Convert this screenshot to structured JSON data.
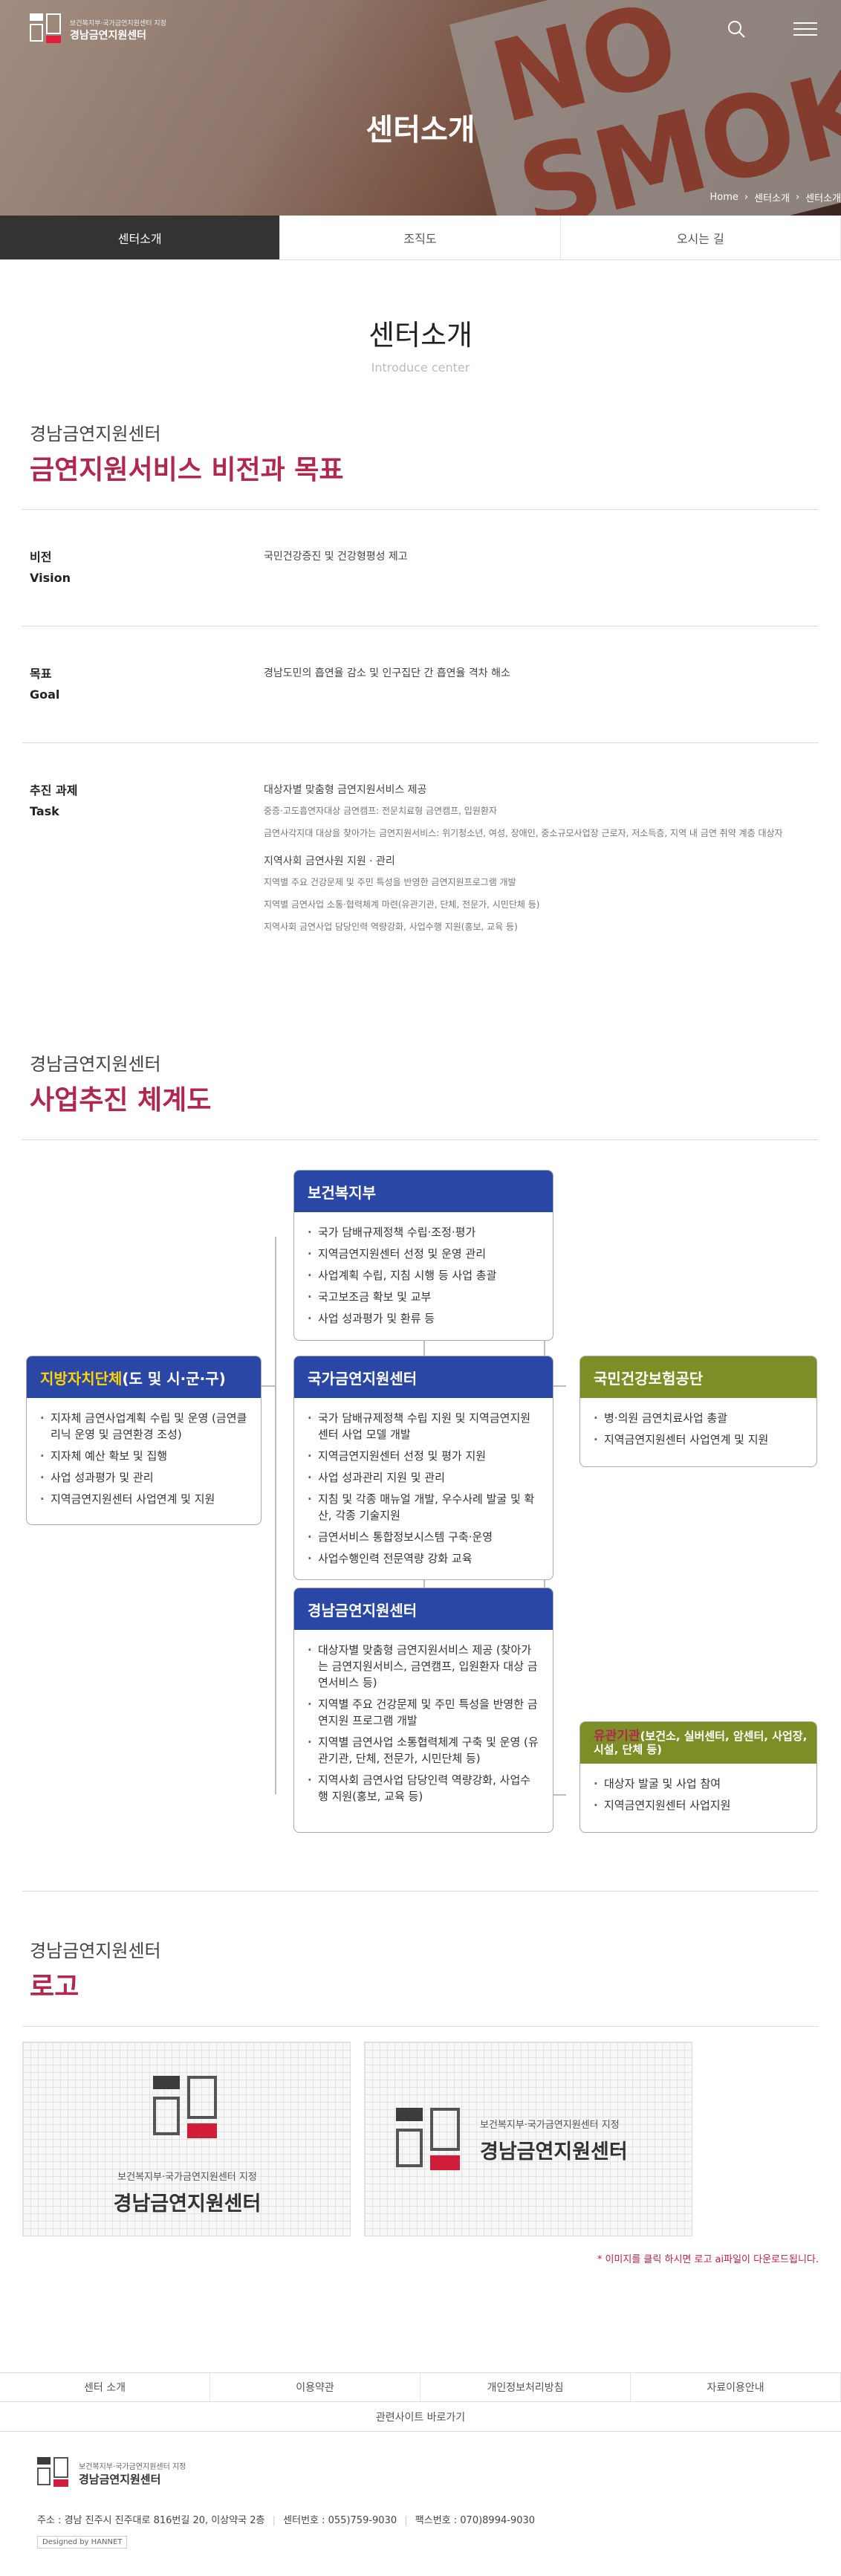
{
  "hero": {
    "logo_small": "보건복지부·국가금연지원센터 지정",
    "logo_name": "경남금연지원센터",
    "title": "센터소개",
    "sign_text": "NO SMOKING",
    "breadcrumb": [
      "Home",
      "센터소개",
      "센터소개"
    ]
  },
  "tabs": [
    "센터소개",
    "조직도",
    "오시는 길"
  ],
  "section": {
    "title": "센터소개",
    "subtitle": "Introduce center"
  },
  "vision": {
    "small": "경남금연지원센터",
    "heading": "금연지원서비스 비전과 목표",
    "rows": [
      {
        "label_ko": "비전",
        "label_en": "Vision",
        "text": "국민건강증진 및 건강형평성 제고"
      },
      {
        "label_ko": "목표",
        "label_en": "Goal",
        "text": "경남도민의 흡연율 감소 및 인구집단 간 흡연율 격차 해소"
      }
    ],
    "task": {
      "label_ko": "추진 과제",
      "label_en": "Task",
      "groups": [
        {
          "title": "대상자별 맞춤형 금연지원서비스 제공",
          "items": [
            "중증·고도흡연자대상 금연캠프: 전문치료형 금연캠프, 입원환자",
            "금연사각지대 대상을 찾아가는 금연지원서비스: 위기청소년, 여성, 장애인, 중소규모사업장 근로자, 저소득층, 지역 내 금연 취약 계층 대상자"
          ]
        },
        {
          "title": "지역사회 금연사원 지원 · 관리",
          "items": [
            "지역별 주요 건강문제 및 주민 특성을 반영한 금연지원프로그램 개발",
            "지역별 금연사업 소통·협력체계 마련(유관기관, 단체, 전문가, 시민단체 등)",
            "지역사회 금연사업 담당인력 역량강화, 사업수행 지원(홍보, 교육 등)"
          ]
        }
      ]
    }
  },
  "diagram": {
    "small": "경남금연지원센터",
    "heading": "사업추진 체계도",
    "mohw": {
      "title": "보건복지부",
      "items": [
        "국가 담배규제정책 수립·조정·평가",
        "지역금연지원센터 선정 및 운영 관리",
        "사업계획 수립, 지침 시행 등 사업 총괄",
        "국고보조금 확보 및 교부",
        "사업 성과평가 및 환류 등"
      ]
    },
    "local": {
      "title_a": "지방자치단체",
      "title_b": "(도 및 시·군·구)",
      "items": [
        "지자체 금연사업계획 수립 및 운영 (금연클리닉 운영 및 금연환경 조성)",
        "지자체 예산 확보 및 집행",
        "사업 성과평가 및 관리",
        "지역금연지원센터 사업연계 및 지원"
      ]
    },
    "national": {
      "title": "국가금연지원센터",
      "items": [
        "국가 담배규제정책 수립 지원 및 지역금연지원센터 사업 모델 개발",
        "지역금연지원센터 선정 및 평가 지원",
        "사업 성과관리 지원 및 관리",
        "지침 및 각종 매뉴얼 개발, 우수사례 발굴 및 확산, 각종 기술지원",
        "금연서비스 통합정보시스템 구축·운영",
        "사업수행인력 전문역량 강화 교육"
      ]
    },
    "nhis": {
      "title": "국민건강보험공단",
      "items": [
        "병·의원 금연치료사업 총괄",
        "지역금연지원센터 사업연계 및 지원"
      ]
    },
    "regional": {
      "title": "경남금연지원센터",
      "items": [
        "대상자별 맞춤형 금연지원서비스 제공 (찾아가는 금연지원서비스, 금연캠프, 입원환자 대상 금연서비스 등)",
        "지역별 주요 건강문제 및 주민 특성을 반영한 금연지원 프로그램 개발",
        "지역별 금연사업 소통협력체계 구축 및 운영 (유관기관, 단체, 전문가, 시민단체 등)",
        "지역사회 금연사업 담당인력 역량강화, 사업수행 지원(홍보, 교육 등)"
      ]
    },
    "related": {
      "title_a": "유관기관",
      "title_b": "(보건소, 실버센터, 암센터, 사업장, 시설, 단체 등)",
      "items": [
        "대상자 발굴 및 사업 참여",
        "지역금연지원센터 사업지원"
      ]
    }
  },
  "logo_section": {
    "small": "경남금연지원센터",
    "heading": "로고",
    "card_small": "보건복지부·국가금연지원센터 지정",
    "card_name": "경남금연지원센터",
    "note": "* 이미지를 클릭 하시면 로고 ai파일이 다운로드됩니다."
  },
  "footer": {
    "nav": [
      "센터 소개",
      "이용약관",
      "개인정보처리방침",
      "자료이용안내"
    ],
    "related": "관련사이트 바로가기",
    "logo_small": "보건복지부·국가금연지원센터 지정",
    "logo_name": "경남금연지원센터",
    "address": "주소 : 경남 진주시 진주대로 816번길 20, 이상약국 2층",
    "phone": "센터번호 : 055)759-9030",
    "fax": "팩스번호 : 070)8994-9030",
    "designer": "Designed by HANNET"
  },
  "colors": {
    "accent": "#b0284e",
    "blue": "#2b47a6",
    "green": "#7b8f26",
    "yellow": "#ffd400"
  }
}
